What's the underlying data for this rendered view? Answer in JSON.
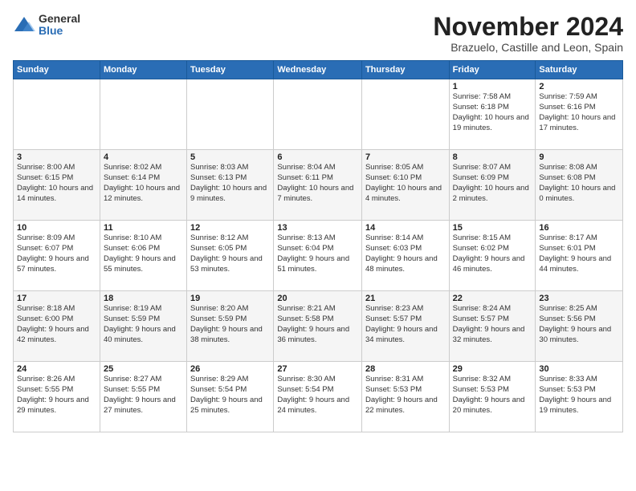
{
  "logo": {
    "general": "General",
    "blue": "Blue"
  },
  "title": "November 2024",
  "location": "Brazuelo, Castille and Leon, Spain",
  "days_of_week": [
    "Sunday",
    "Monday",
    "Tuesday",
    "Wednesday",
    "Thursday",
    "Friday",
    "Saturday"
  ],
  "weeks": [
    [
      {
        "day": "",
        "info": ""
      },
      {
        "day": "",
        "info": ""
      },
      {
        "day": "",
        "info": ""
      },
      {
        "day": "",
        "info": ""
      },
      {
        "day": "",
        "info": ""
      },
      {
        "day": "1",
        "info": "Sunrise: 7:58 AM\nSunset: 6:18 PM\nDaylight: 10 hours and 19 minutes."
      },
      {
        "day": "2",
        "info": "Sunrise: 7:59 AM\nSunset: 6:16 PM\nDaylight: 10 hours and 17 minutes."
      }
    ],
    [
      {
        "day": "3",
        "info": "Sunrise: 8:00 AM\nSunset: 6:15 PM\nDaylight: 10 hours and 14 minutes."
      },
      {
        "day": "4",
        "info": "Sunrise: 8:02 AM\nSunset: 6:14 PM\nDaylight: 10 hours and 12 minutes."
      },
      {
        "day": "5",
        "info": "Sunrise: 8:03 AM\nSunset: 6:13 PM\nDaylight: 10 hours and 9 minutes."
      },
      {
        "day": "6",
        "info": "Sunrise: 8:04 AM\nSunset: 6:11 PM\nDaylight: 10 hours and 7 minutes."
      },
      {
        "day": "7",
        "info": "Sunrise: 8:05 AM\nSunset: 6:10 PM\nDaylight: 10 hours and 4 minutes."
      },
      {
        "day": "8",
        "info": "Sunrise: 8:07 AM\nSunset: 6:09 PM\nDaylight: 10 hours and 2 minutes."
      },
      {
        "day": "9",
        "info": "Sunrise: 8:08 AM\nSunset: 6:08 PM\nDaylight: 10 hours and 0 minutes."
      }
    ],
    [
      {
        "day": "10",
        "info": "Sunrise: 8:09 AM\nSunset: 6:07 PM\nDaylight: 9 hours and 57 minutes."
      },
      {
        "day": "11",
        "info": "Sunrise: 8:10 AM\nSunset: 6:06 PM\nDaylight: 9 hours and 55 minutes."
      },
      {
        "day": "12",
        "info": "Sunrise: 8:12 AM\nSunset: 6:05 PM\nDaylight: 9 hours and 53 minutes."
      },
      {
        "day": "13",
        "info": "Sunrise: 8:13 AM\nSunset: 6:04 PM\nDaylight: 9 hours and 51 minutes."
      },
      {
        "day": "14",
        "info": "Sunrise: 8:14 AM\nSunset: 6:03 PM\nDaylight: 9 hours and 48 minutes."
      },
      {
        "day": "15",
        "info": "Sunrise: 8:15 AM\nSunset: 6:02 PM\nDaylight: 9 hours and 46 minutes."
      },
      {
        "day": "16",
        "info": "Sunrise: 8:17 AM\nSunset: 6:01 PM\nDaylight: 9 hours and 44 minutes."
      }
    ],
    [
      {
        "day": "17",
        "info": "Sunrise: 8:18 AM\nSunset: 6:00 PM\nDaylight: 9 hours and 42 minutes."
      },
      {
        "day": "18",
        "info": "Sunrise: 8:19 AM\nSunset: 5:59 PM\nDaylight: 9 hours and 40 minutes."
      },
      {
        "day": "19",
        "info": "Sunrise: 8:20 AM\nSunset: 5:59 PM\nDaylight: 9 hours and 38 minutes."
      },
      {
        "day": "20",
        "info": "Sunrise: 8:21 AM\nSunset: 5:58 PM\nDaylight: 9 hours and 36 minutes."
      },
      {
        "day": "21",
        "info": "Sunrise: 8:23 AM\nSunset: 5:57 PM\nDaylight: 9 hours and 34 minutes."
      },
      {
        "day": "22",
        "info": "Sunrise: 8:24 AM\nSunset: 5:57 PM\nDaylight: 9 hours and 32 minutes."
      },
      {
        "day": "23",
        "info": "Sunrise: 8:25 AM\nSunset: 5:56 PM\nDaylight: 9 hours and 30 minutes."
      }
    ],
    [
      {
        "day": "24",
        "info": "Sunrise: 8:26 AM\nSunset: 5:55 PM\nDaylight: 9 hours and 29 minutes."
      },
      {
        "day": "25",
        "info": "Sunrise: 8:27 AM\nSunset: 5:55 PM\nDaylight: 9 hours and 27 minutes."
      },
      {
        "day": "26",
        "info": "Sunrise: 8:29 AM\nSunset: 5:54 PM\nDaylight: 9 hours and 25 minutes."
      },
      {
        "day": "27",
        "info": "Sunrise: 8:30 AM\nSunset: 5:54 PM\nDaylight: 9 hours and 24 minutes."
      },
      {
        "day": "28",
        "info": "Sunrise: 8:31 AM\nSunset: 5:53 PM\nDaylight: 9 hours and 22 minutes."
      },
      {
        "day": "29",
        "info": "Sunrise: 8:32 AM\nSunset: 5:53 PM\nDaylight: 9 hours and 20 minutes."
      },
      {
        "day": "30",
        "info": "Sunrise: 8:33 AM\nSunset: 5:53 PM\nDaylight: 9 hours and 19 minutes."
      }
    ]
  ]
}
